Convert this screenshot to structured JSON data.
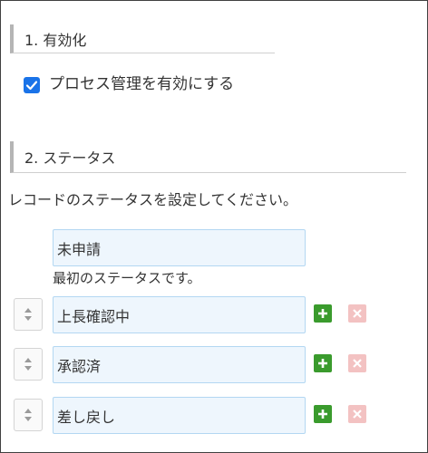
{
  "sections": {
    "enable": {
      "title": "1. 有効化"
    },
    "status": {
      "title": "2. ステータス"
    }
  },
  "enable": {
    "checkbox_label": "プロセス管理を有効にする",
    "checked": true
  },
  "status": {
    "description": "レコードのステータスを設定してください。",
    "initial": {
      "value": "未申請",
      "note": "最初のステータスです。"
    },
    "rows": [
      {
        "value": "上長確認中"
      },
      {
        "value": "承認済"
      },
      {
        "value": "差し戻し"
      }
    ]
  },
  "icons": {
    "checkbox": "checkmark-icon",
    "handle": "drag-handle-icon",
    "add": "plus-icon",
    "delete": "x-icon"
  },
  "colors": {
    "checkbox": "#1a73e8",
    "input_bg": "#eef6fd",
    "input_border": "#b3d7f2",
    "add_button": "#3a9b2d",
    "delete_button": "#f3c2c2"
  }
}
